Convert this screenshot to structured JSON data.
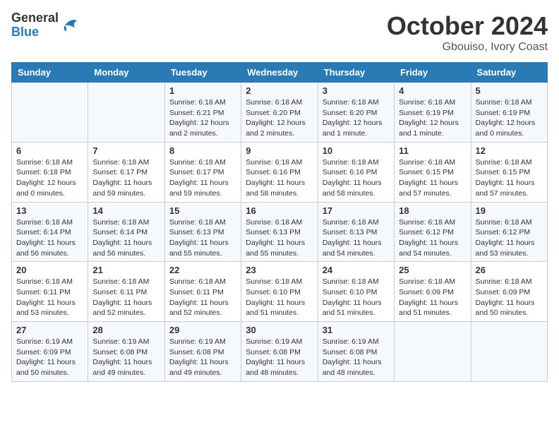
{
  "header": {
    "logo": {
      "line1": "General",
      "line2": "Blue"
    },
    "title": "October 2024",
    "subtitle": "Gbouiso, Ivory Coast"
  },
  "weekdays": [
    "Sunday",
    "Monday",
    "Tuesday",
    "Wednesday",
    "Thursday",
    "Friday",
    "Saturday"
  ],
  "weeks": [
    [
      {
        "day": null,
        "info": null
      },
      {
        "day": null,
        "info": null
      },
      {
        "day": "1",
        "info": "Sunrise: 6:18 AM\nSunset: 6:21 PM\nDaylight: 12 hours and 2 minutes."
      },
      {
        "day": "2",
        "info": "Sunrise: 6:18 AM\nSunset: 6:20 PM\nDaylight: 12 hours and 2 minutes."
      },
      {
        "day": "3",
        "info": "Sunrise: 6:18 AM\nSunset: 6:20 PM\nDaylight: 12 hours and 1 minute."
      },
      {
        "day": "4",
        "info": "Sunrise: 6:18 AM\nSunset: 6:19 PM\nDaylight: 12 hours and 1 minute."
      },
      {
        "day": "5",
        "info": "Sunrise: 6:18 AM\nSunset: 6:19 PM\nDaylight: 12 hours and 0 minutes."
      }
    ],
    [
      {
        "day": "6",
        "info": "Sunrise: 6:18 AM\nSunset: 6:18 PM\nDaylight: 12 hours and 0 minutes."
      },
      {
        "day": "7",
        "info": "Sunrise: 6:18 AM\nSunset: 6:17 PM\nDaylight: 11 hours and 59 minutes."
      },
      {
        "day": "8",
        "info": "Sunrise: 6:18 AM\nSunset: 6:17 PM\nDaylight: 11 hours and 59 minutes."
      },
      {
        "day": "9",
        "info": "Sunrise: 6:18 AM\nSunset: 6:16 PM\nDaylight: 11 hours and 58 minutes."
      },
      {
        "day": "10",
        "info": "Sunrise: 6:18 AM\nSunset: 6:16 PM\nDaylight: 11 hours and 58 minutes."
      },
      {
        "day": "11",
        "info": "Sunrise: 6:18 AM\nSunset: 6:15 PM\nDaylight: 11 hours and 57 minutes."
      },
      {
        "day": "12",
        "info": "Sunrise: 6:18 AM\nSunset: 6:15 PM\nDaylight: 11 hours and 57 minutes."
      }
    ],
    [
      {
        "day": "13",
        "info": "Sunrise: 6:18 AM\nSunset: 6:14 PM\nDaylight: 11 hours and 56 minutes."
      },
      {
        "day": "14",
        "info": "Sunrise: 6:18 AM\nSunset: 6:14 PM\nDaylight: 11 hours and 56 minutes."
      },
      {
        "day": "15",
        "info": "Sunrise: 6:18 AM\nSunset: 6:13 PM\nDaylight: 11 hours and 55 minutes."
      },
      {
        "day": "16",
        "info": "Sunrise: 6:18 AM\nSunset: 6:13 PM\nDaylight: 11 hours and 55 minutes."
      },
      {
        "day": "17",
        "info": "Sunrise: 6:18 AM\nSunset: 6:13 PM\nDaylight: 11 hours and 54 minutes."
      },
      {
        "day": "18",
        "info": "Sunrise: 6:18 AM\nSunset: 6:12 PM\nDaylight: 11 hours and 54 minutes."
      },
      {
        "day": "19",
        "info": "Sunrise: 6:18 AM\nSunset: 6:12 PM\nDaylight: 11 hours and 53 minutes."
      }
    ],
    [
      {
        "day": "20",
        "info": "Sunrise: 6:18 AM\nSunset: 6:11 PM\nDaylight: 11 hours and 53 minutes."
      },
      {
        "day": "21",
        "info": "Sunrise: 6:18 AM\nSunset: 6:11 PM\nDaylight: 11 hours and 52 minutes."
      },
      {
        "day": "22",
        "info": "Sunrise: 6:18 AM\nSunset: 6:11 PM\nDaylight: 11 hours and 52 minutes."
      },
      {
        "day": "23",
        "info": "Sunrise: 6:18 AM\nSunset: 6:10 PM\nDaylight: 11 hours and 51 minutes."
      },
      {
        "day": "24",
        "info": "Sunrise: 6:18 AM\nSunset: 6:10 PM\nDaylight: 11 hours and 51 minutes."
      },
      {
        "day": "25",
        "info": "Sunrise: 6:18 AM\nSunset: 6:09 PM\nDaylight: 11 hours and 51 minutes."
      },
      {
        "day": "26",
        "info": "Sunrise: 6:18 AM\nSunset: 6:09 PM\nDaylight: 11 hours and 50 minutes."
      }
    ],
    [
      {
        "day": "27",
        "info": "Sunrise: 6:19 AM\nSunset: 6:09 PM\nDaylight: 11 hours and 50 minutes."
      },
      {
        "day": "28",
        "info": "Sunrise: 6:19 AM\nSunset: 6:08 PM\nDaylight: 11 hours and 49 minutes."
      },
      {
        "day": "29",
        "info": "Sunrise: 6:19 AM\nSunset: 6:08 PM\nDaylight: 11 hours and 49 minutes."
      },
      {
        "day": "30",
        "info": "Sunrise: 6:19 AM\nSunset: 6:08 PM\nDaylight: 11 hours and 48 minutes."
      },
      {
        "day": "31",
        "info": "Sunrise: 6:19 AM\nSunset: 6:08 PM\nDaylight: 11 hours and 48 minutes."
      },
      {
        "day": null,
        "info": null
      },
      {
        "day": null,
        "info": null
      }
    ]
  ]
}
